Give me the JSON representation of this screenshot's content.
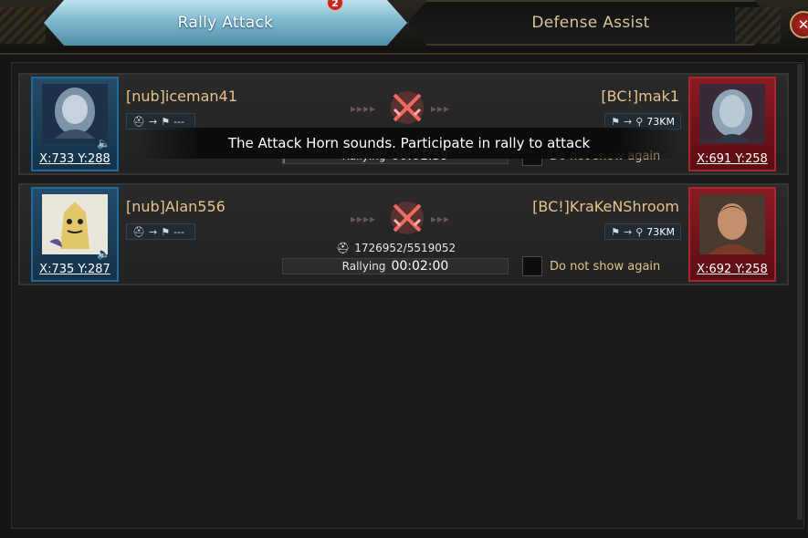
{
  "tabs": {
    "active_label": "Rally Attack",
    "active_badge": "2",
    "inactive_label": "Defense Assist"
  },
  "close_icon": "close-icon",
  "tooltip": "The Attack Horn sounds. Participate in rally to attack",
  "rallies": [
    {
      "leader": "[nub]iceman41",
      "leader_coords": "X:733 Y:288",
      "target": "[BC!]mak1",
      "target_coords": "X:691 Y:258",
      "route_left": "---",
      "distance": "73KM",
      "troops": "",
      "status": "Rallying",
      "timer": "00:01:59",
      "checkbox_label": "Do not show again",
      "progress_fraction": 0.01
    },
    {
      "leader": "[nub]Alan556",
      "leader_coords": "X:735 Y:287",
      "target": "[BC!]KraKeNShroom",
      "target_coords": "X:692 Y:258",
      "route_left": "---",
      "distance": "73KM",
      "troops": "1726952/5519052",
      "status": "Rallying",
      "timer": "00:02:00",
      "checkbox_label": "Do not show again",
      "progress_fraction": 0.0
    }
  ],
  "colors": {
    "active_tab": "#7fb9cf",
    "leader_frame": "#1f6a99",
    "target_frame": "#a8272e",
    "name_text": "#e6c48b",
    "swords": "#e6514a"
  }
}
